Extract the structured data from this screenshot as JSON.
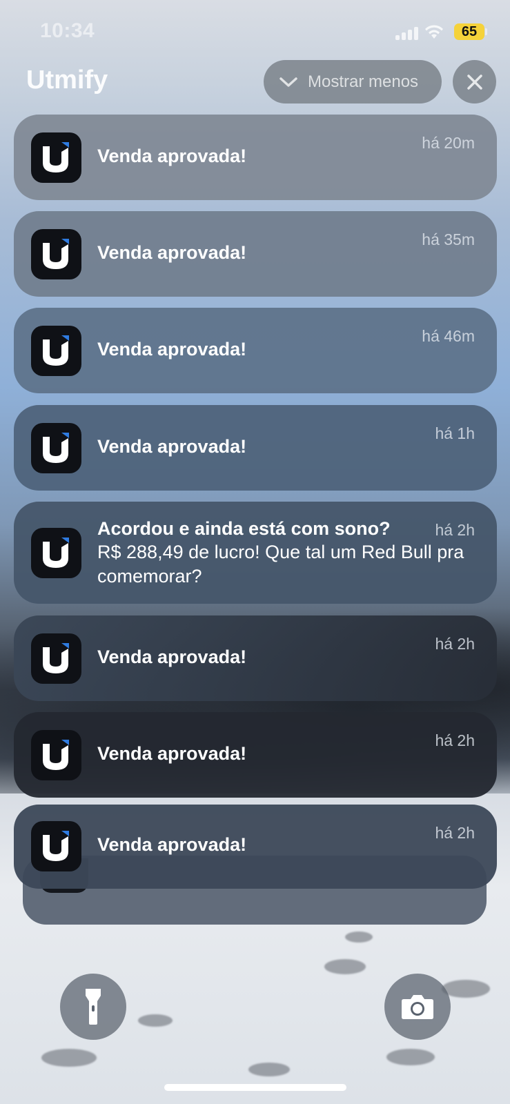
{
  "status_bar": {
    "time": "10:34",
    "battery": "65"
  },
  "header": {
    "app_name": "Utmify",
    "show_less": "Mostrar menos"
  },
  "notifications": [
    {
      "title": "Venda aprovada!",
      "time": "há 20m"
    },
    {
      "title": "Venda aprovada!",
      "time": "há 35m"
    },
    {
      "title": "Venda aprovada!",
      "time": "há 46m"
    },
    {
      "title": "Venda aprovada!",
      "time": "há 1h"
    },
    {
      "title": "Acordou e ainda está com sono?",
      "body": "R$ 288,49 de lucro! Que tal um Red Bull pra comemorar?",
      "time": "há 2h"
    },
    {
      "title": "Venda aprovada!",
      "time": "há 2h"
    },
    {
      "title": "Venda aprovada!",
      "time": "há 2h"
    },
    {
      "title": "Venda aprovada!",
      "time": "há 2h"
    }
  ],
  "controls": {
    "flashlight": "flashlight-icon",
    "camera": "camera-icon"
  },
  "colors": {
    "battery": "#f5d23a",
    "app_icon_bg": "#0f1116",
    "app_icon_accent": "#2f7be0"
  }
}
